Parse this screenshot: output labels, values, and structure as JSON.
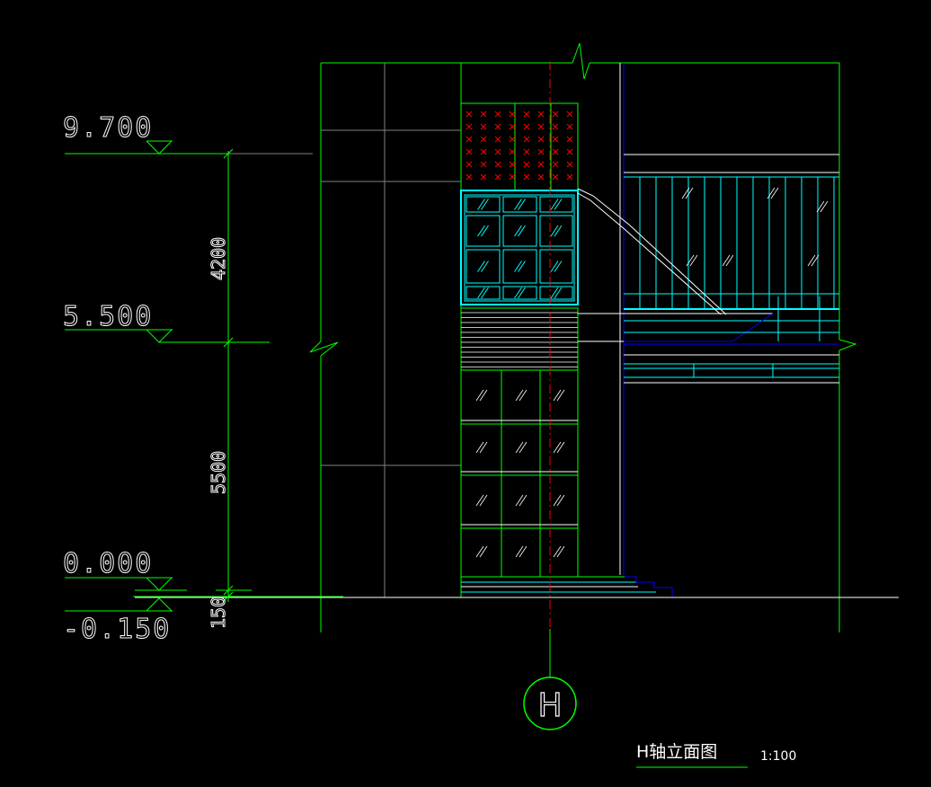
{
  "levels": [
    {
      "label": "9.700"
    },
    {
      "label": "5.500"
    },
    {
      "label": "0.000"
    },
    {
      "label": "-0.150"
    }
  ],
  "dimensions": [
    {
      "label": "4200"
    },
    {
      "label": "5500"
    },
    {
      "label": "150"
    }
  ],
  "axis_bubble": {
    "label": "H"
  },
  "drawing_title": {
    "text": "H轴立面图",
    "scale": "1:100"
  },
  "colors": {
    "background": "#000000",
    "green": "#00ff00",
    "white": "#ffffff",
    "cyan": "#00ffff",
    "blue": "#0000ff",
    "red": "#ff0000",
    "gray": "#808080"
  }
}
